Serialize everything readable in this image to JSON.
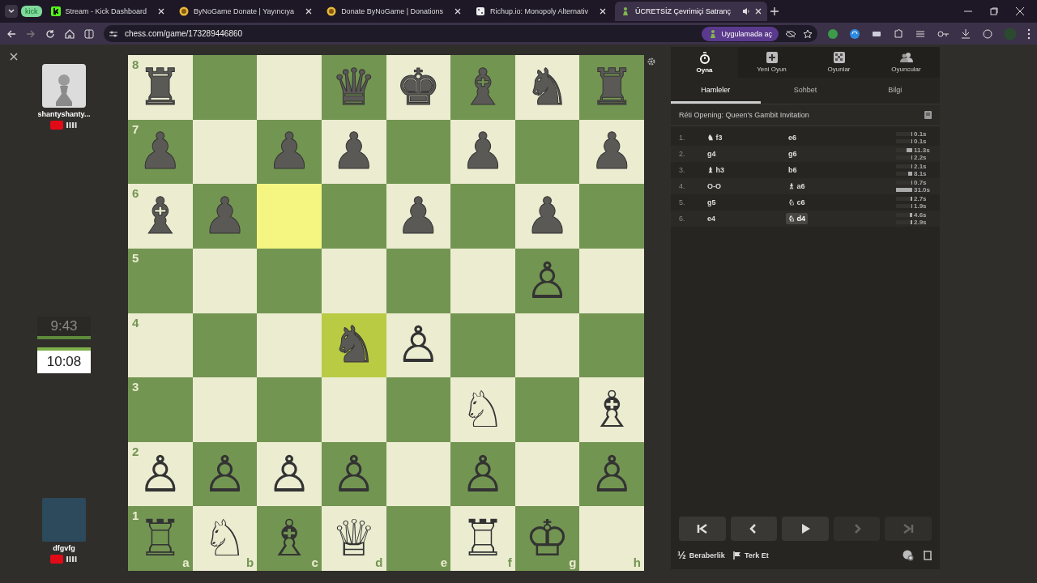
{
  "browser": {
    "group_label": "kick",
    "tabs": [
      {
        "title": "Stream - Kick Dashboard",
        "kind": "kick",
        "selected": false,
        "audio": false
      },
      {
        "title": "ByNoGame Donate | Yayıncıya",
        "kind": "coin",
        "selected": false,
        "audio": false
      },
      {
        "title": "Donate ByNoGame | Donations",
        "kind": "coin",
        "selected": false,
        "audio": false
      },
      {
        "title": "Richup.io: Monopoly Alternativ",
        "kind": "die",
        "selected": false,
        "audio": false
      },
      {
        "title": "ÜCRETSİZ Çevrimiçi Satranç",
        "kind": "pawn",
        "selected": true,
        "audio": true
      }
    ],
    "url": "chess.com/game/173289446860",
    "open_in_app": "Uygulamada aç"
  },
  "players": [
    {
      "name": "shantyshanty...",
      "kind": "pawn",
      "clock": "9:43",
      "active": false
    },
    {
      "name": "dfgvfg",
      "kind": "photo",
      "clock": "10:08",
      "active": true
    }
  ],
  "board": {
    "files": [
      "a",
      "b",
      "c",
      "d",
      "e",
      "f",
      "g",
      "h"
    ],
    "ranks": [
      {
        "label": "8",
        "squares": [
          {
            "piece": "♜",
            "kind": "black",
            "highlighted": false
          },
          {
            "highlighted": false
          },
          {
            "highlighted": false
          },
          {
            "piece": "♛",
            "kind": "black",
            "highlighted": false
          },
          {
            "piece": "♚",
            "kind": "black",
            "highlighted": false
          },
          {
            "piece": "♝",
            "kind": "black",
            "highlighted": false
          },
          {
            "piece": "♞",
            "kind": "black",
            "highlighted": false
          },
          {
            "piece": "♜",
            "kind": "black",
            "highlighted": false
          }
        ]
      },
      {
        "label": "7",
        "squares": [
          {
            "piece": "♟",
            "kind": "black",
            "highlighted": false
          },
          {
            "highlighted": false
          },
          {
            "piece": "♟",
            "kind": "black",
            "highlighted": false
          },
          {
            "piece": "♟",
            "kind": "black",
            "highlighted": false
          },
          {
            "highlighted": false
          },
          {
            "piece": "♟",
            "kind": "black",
            "highlighted": false
          },
          {
            "highlighted": false
          },
          {
            "piece": "♟",
            "kind": "black",
            "highlighted": false
          }
        ]
      },
      {
        "label": "6",
        "squares": [
          {
            "piece": "♝",
            "kind": "black",
            "highlighted": false
          },
          {
            "piece": "♟",
            "kind": "black",
            "highlighted": false
          },
          {
            "highlighted": true
          },
          {
            "highlighted": false
          },
          {
            "piece": "♟",
            "kind": "black",
            "highlighted": false
          },
          {
            "highlighted": false
          },
          {
            "piece": "♟",
            "kind": "black",
            "highlighted": false
          },
          {
            "highlighted": false
          }
        ]
      },
      {
        "label": "5",
        "squares": [
          {
            "highlighted": false
          },
          {
            "highlighted": false
          },
          {
            "highlighted": false
          },
          {
            "highlighted": false
          },
          {
            "highlighted": false
          },
          {
            "highlighted": false
          },
          {
            "piece": "♙",
            "kind": "white",
            "highlighted": false
          },
          {
            "highlighted": false
          }
        ]
      },
      {
        "label": "4",
        "squares": [
          {
            "highlighted": false
          },
          {
            "highlighted": false
          },
          {
            "highlighted": false
          },
          {
            "piece": "♞",
            "kind": "black",
            "highlighted": true
          },
          {
            "piece": "♙",
            "kind": "white",
            "highlighted": false
          },
          {
            "highlighted": false
          },
          {
            "highlighted": false
          },
          {
            "highlighted": false
          }
        ]
      },
      {
        "label": "3",
        "squares": [
          {
            "highlighted": false
          },
          {
            "highlighted": false
          },
          {
            "highlighted": false
          },
          {
            "highlighted": false
          },
          {
            "highlighted": false
          },
          {
            "piece": "♘",
            "kind": "white",
            "highlighted": false
          },
          {
            "highlighted": false
          },
          {
            "piece": "♗",
            "kind": "white",
            "highlighted": false
          }
        ]
      },
      {
        "label": "2",
        "squares": [
          {
            "piece": "♙",
            "kind": "white",
            "highlighted": false
          },
          {
            "piece": "♙",
            "kind": "white",
            "highlighted": false
          },
          {
            "piece": "♙",
            "kind": "white",
            "highlighted": false
          },
          {
            "piece": "♙",
            "kind": "white",
            "highlighted": false
          },
          {
            "highlighted": false
          },
          {
            "piece": "♙",
            "kind": "white",
            "highlighted": false
          },
          {
            "highlighted": false
          },
          {
            "piece": "♙",
            "kind": "white",
            "highlighted": false
          }
        ]
      },
      {
        "label": "1",
        "squares": [
          {
            "piece": "♖",
            "kind": "white",
            "highlighted": false
          },
          {
            "piece": "♘",
            "kind": "white",
            "highlighted": false
          },
          {
            "piece": "♗",
            "kind": "white",
            "highlighted": false
          },
          {
            "piece": "♕",
            "kind": "white",
            "highlighted": false
          },
          {
            "highlighted": false
          },
          {
            "piece": "♖",
            "kind": "white",
            "highlighted": false
          },
          {
            "piece": "♔",
            "kind": "white",
            "highlighted": false
          },
          {
            "highlighted": false
          }
        ]
      }
    ]
  },
  "panel": {
    "nav": [
      {
        "label": "Oyna",
        "kind": "stopwatch",
        "selected": true
      },
      {
        "label": "Yeni Oyun",
        "kind": "plus",
        "selected": false
      },
      {
        "label": "Oyunlar",
        "kind": "board",
        "selected": false
      },
      {
        "label": "Oyuncular",
        "kind": "people",
        "selected": false
      }
    ],
    "tabs": [
      {
        "label": "Hamleler",
        "selected": true
      },
      {
        "label": "Sohbet",
        "selected": false
      },
      {
        "label": "Bilgi",
        "selected": false
      }
    ],
    "opening": "Réti Opening: Queen's Gambit Invitation",
    "moves": [
      {
        "number": "1.",
        "white": {
          "piece": "♞",
          "san": "f3",
          "selected": false
        },
        "black": {
          "san": "e6",
          "selected": false
        },
        "times": [
          {
            "text": "0.1s",
            "level": 0.03
          },
          {
            "text": "0.1s",
            "level": 0.03
          }
        ]
      },
      {
        "number": "2.",
        "white": {
          "san": "g4",
          "selected": false
        },
        "black": {
          "san": "g6",
          "selected": false
        },
        "times": [
          {
            "text": "11.3s",
            "level": 0.36
          },
          {
            "text": "2.2s",
            "level": 0.07
          }
        ]
      },
      {
        "number": "3.",
        "white": {
          "piece": "♝",
          "san": "h3",
          "selected": false
        },
        "black": {
          "san": "b6",
          "selected": false
        },
        "times": [
          {
            "text": "2.1s",
            "level": 0.07
          },
          {
            "text": "8.1s",
            "level": 0.26
          }
        ]
      },
      {
        "number": "4.",
        "white": {
          "san": "O-O",
          "selected": false
        },
        "black": {
          "piece": "♗",
          "san": "a6",
          "selected": false
        },
        "times": [
          {
            "text": "0.7s",
            "level": 0.03
          },
          {
            "text": "31.0s",
            "level": 1
          }
        ]
      },
      {
        "number": "5.",
        "white": {
          "san": "g5",
          "selected": false
        },
        "black": {
          "piece": "♘",
          "san": "c6",
          "selected": false
        },
        "times": [
          {
            "text": "2.7s",
            "level": 0.09
          },
          {
            "text": "1.9s",
            "level": 0.06
          }
        ]
      },
      {
        "number": "6.",
        "white": {
          "san": "e4",
          "selected": false
        },
        "black": {
          "piece": "♘",
          "san": "d4",
          "selected": true
        },
        "times": [
          {
            "text": "4.6s",
            "level": 0.15
          },
          {
            "text": "2.9s",
            "level": 0.09
          }
        ]
      }
    ],
    "controls": [
      {
        "kind": "first",
        "disabled": false
      },
      {
        "kind": "prev",
        "disabled": false
      },
      {
        "kind": "play",
        "disabled": false
      },
      {
        "kind": "next",
        "disabled": true
      },
      {
        "kind": "last",
        "disabled": true
      }
    ],
    "draw": {
      "glyph": "½",
      "label": "Beraberlik"
    },
    "resign": "Terk Et"
  }
}
